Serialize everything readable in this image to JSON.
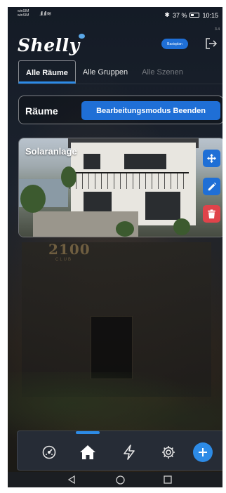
{
  "status_bar": {
    "sim_label_1": "winSIM",
    "sim_label_2": "winSIM",
    "signal": ".ıll .ıll ≋",
    "battery": "37 %",
    "time": "10:15"
  },
  "header": {
    "logo": "Shelly",
    "version": "3.4",
    "plan_badge": "Basisplan"
  },
  "tabs": [
    {
      "label": "Alle Räume",
      "active": true
    },
    {
      "label": "Alle Gruppen",
      "active": false
    },
    {
      "label": "Alle Szenen",
      "active": false
    }
  ],
  "rooms_bar": {
    "title": "Räume",
    "edit_mode_button": "Bearbeitungsmodus Beenden"
  },
  "room_card": {
    "title": "Solaranlage"
  },
  "background": {
    "sign": "2100",
    "sign_sub": "CLUB"
  },
  "bottom_nav": {
    "items": [
      "gauge-icon",
      "home-icon",
      "lightning-icon",
      "gear-icon",
      "add-icon"
    ],
    "active": "home-icon"
  },
  "colors": {
    "accent": "#2d8be6",
    "button_blue": "#1f6fd6",
    "delete_red": "#e0434a",
    "background": "#181f29"
  }
}
